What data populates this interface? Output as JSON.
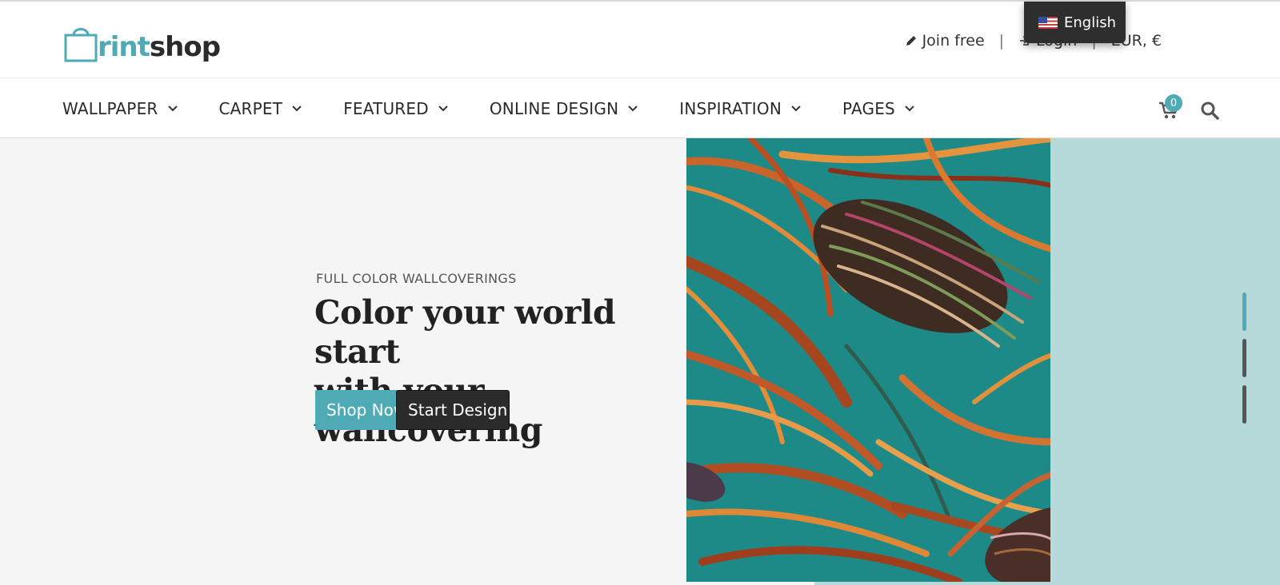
{
  "header": {
    "logo_text_a": "rint",
    "logo_text_b": "shop",
    "join_label": "Join free",
    "separator": "|",
    "login_label": "Login",
    "currency_label": "EUR, €",
    "language_label": "English"
  },
  "nav": {
    "items": [
      {
        "label": "WALLPAPER"
      },
      {
        "label": "CARPET"
      },
      {
        "label": "FEATURED"
      },
      {
        "label": "ONLINE DESIGN"
      },
      {
        "label": "INSPIRATION"
      },
      {
        "label": "PAGES"
      }
    ],
    "cart_count": "0"
  },
  "hero": {
    "eyebrow": "FULL COLOR WALLCOVERINGS",
    "headline_line1": "Color your world start",
    "headline_line2": "with your wallcovering",
    "shop_button": "Shop Now",
    "start_button": "Start Design",
    "slides_total": 3,
    "active_slide": 1
  },
  "colors": {
    "brand_teal": "#4eaab5",
    "dark": "#2b2b2b",
    "hero_bg": "#f5f5f5",
    "side_panel": "#b6d9da"
  }
}
